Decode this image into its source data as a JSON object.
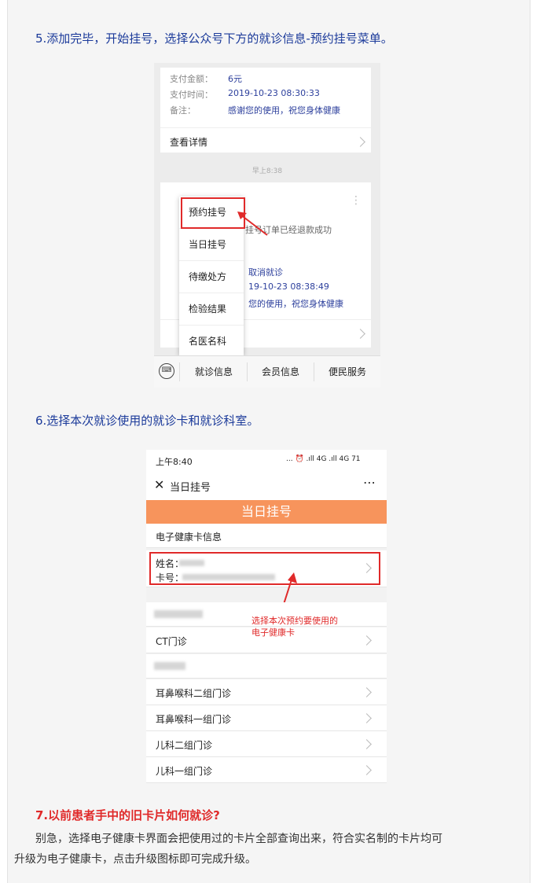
{
  "step5": "5.添加完毕，开始挂号，选择公众号下方的就诊信息-预约挂号菜单。",
  "shot1": {
    "pay_amount_label": "支付金额：",
    "pay_amount": "6元",
    "pay_time_label": "支付时间：",
    "pay_time": "2019-10-23 08:30:33",
    "note_label": "备注：",
    "note": "感谢您的使用，祝您身体健康",
    "view_details": "查看详情",
    "timestamp": "早上8:38",
    "card2_line1": "挂号订单已经退款成功",
    "card2_line2": "取消就诊",
    "card2_line3": "19-10-23 08:38:49",
    "card2_line4": "您的使用，祝您身体健康",
    "menu_items": [
      "预约挂号",
      "当日挂号",
      "待缴处方",
      "检验结果",
      "名医名科"
    ],
    "menubar": [
      "就诊信息",
      "会员信息",
      "便民服务"
    ]
  },
  "step6": "6.选择本次就诊使用的就诊卡和就诊科室。",
  "shot2": {
    "status_time": "上午8:40",
    "status_icons": "... ⏰ .ıll 4G .ıll 4G 71",
    "nav_title": "当日挂号",
    "header": "当日挂号",
    "section": "电子健康卡信息",
    "name_label": "姓名：",
    "card_label": "卡号：",
    "annotation_line1": "选择本次预约要使用的",
    "annotation_line2": "电子健康卡",
    "departments": [
      "CT门诊",
      "耳鼻喉科二组门诊",
      "耳鼻喉科一组门诊",
      "儿科二组门诊",
      "儿科一组门诊"
    ]
  },
  "step7_title": "7.以前患者手中的旧卡片如何就诊?",
  "step7_line1": "别急，选择电子健康卡界面会把使用过的卡片全部查询出来，符合实名制的卡片均可",
  "step7_line2": "升级为电子健康卡，点击升级图标即可完成升级。",
  "colors": {
    "accent_orange": "#f7945c",
    "link_blue": "#1b3a9a",
    "highlight_red": "#e02a2a"
  }
}
